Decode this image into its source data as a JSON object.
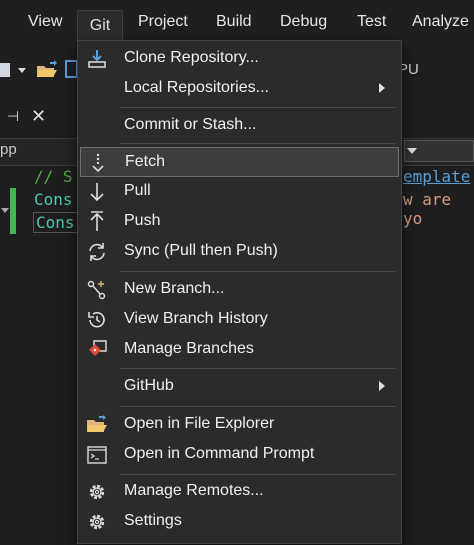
{
  "menubar": {
    "items": [
      "View",
      "Git",
      "Project",
      "Build",
      "Debug",
      "Test",
      "Analyze"
    ]
  },
  "background": {
    "address_fragment": "pp",
    "toolbar_fragment": "PU",
    "code_lines": [
      "// S",
      "Cons",
      "Cons"
    ],
    "code_right": [
      "emplate",
      "w are yo"
    ]
  },
  "git_menu": {
    "items": [
      {
        "label": "Clone Repository...",
        "icon": "clone-download-icon"
      },
      {
        "label": "Local Repositories...",
        "icon": "none",
        "submenu": true
      },
      {
        "label": "Commit or Stash...",
        "icon": "none"
      },
      {
        "label": "Fetch",
        "icon": "fetch-icon",
        "highlighted": true
      },
      {
        "label": "Pull",
        "icon": "pull-arrow-icon"
      },
      {
        "label": "Push",
        "icon": "push-arrow-icon"
      },
      {
        "label": "Sync (Pull then Push)",
        "icon": "sync-icon"
      },
      {
        "label": "New Branch...",
        "icon": "new-branch-icon"
      },
      {
        "label": "View Branch History",
        "icon": "history-icon"
      },
      {
        "label": "Manage Branches",
        "icon": "manage-branches-icon"
      },
      {
        "label": "GitHub",
        "icon": "none",
        "submenu": true
      },
      {
        "label": "Open in File Explorer",
        "icon": "folder-open-icon"
      },
      {
        "label": "Open in Command Prompt",
        "icon": "terminal-icon"
      },
      {
        "label": "Manage Remotes...",
        "icon": "gear-icon"
      },
      {
        "label": "Settings",
        "icon": "gear-icon"
      }
    ]
  },
  "colors": {
    "menu_bg": "#2b2b2b",
    "highlight_bg": "#3d3d3d",
    "code_keyword": "#4ec9b0",
    "code_comment": "#57a64a",
    "accent_green": "#3fb950"
  }
}
